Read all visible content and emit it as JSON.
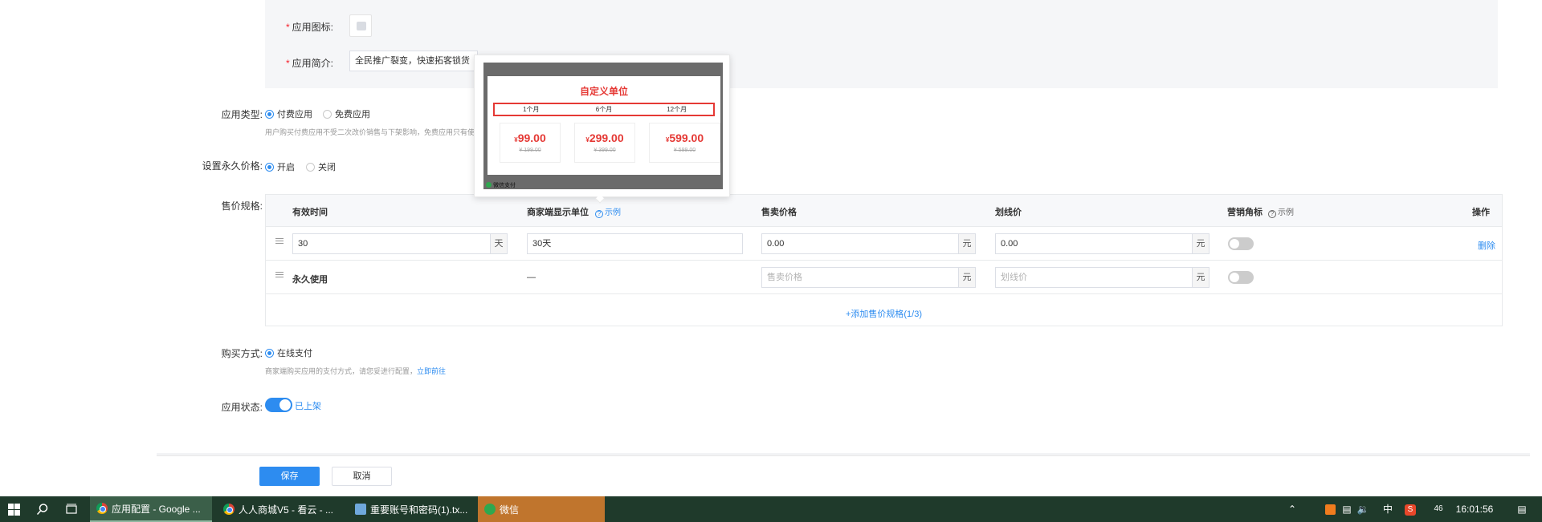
{
  "form": {
    "app_icon_label": "应用图标:",
    "app_intro_label": "应用简介:",
    "app_intro_value": "全民推广裂变，快速拓客锁货",
    "app_type_label": "应用类型:",
    "app_type_options": [
      "付费应用",
      "免费应用"
    ],
    "app_type_hint": "用户购买付费应用不受二次改价销售与下架影响，免费应用只有使",
    "perm_price_label": "设置永久价格:",
    "perm_price_options": [
      "开启",
      "关闭"
    ],
    "spec_label": "售价规格:",
    "purchase_label": "购买方式:",
    "purchase_option": "在线支付",
    "purchase_hint": "商家端购买应用的支付方式，请您妥进行配置，",
    "purchase_hint_link": "立即前往",
    "status_label": "应用状态:",
    "status_value": "已上架"
  },
  "spec_table": {
    "headers": {
      "duration": "有效时间",
      "unit": "商家端显示单位",
      "unit_help": "示例",
      "price": "售卖价格",
      "strike": "划线价",
      "badge": "营销角标",
      "badge_help": "示例",
      "action": "操作"
    },
    "rows": [
      {
        "duration": "30",
        "duration_suffix": "天",
        "unit": "30天",
        "price": "0.00",
        "price_suffix": "元",
        "strike": "0.00",
        "strike_suffix": "元",
        "action": "删除"
      },
      {
        "duration": "永久使用",
        "unit": "—",
        "price_placeholder": "售卖价格",
        "price_suffix": "元",
        "strike_placeholder": "划线价",
        "strike_suffix": "元"
      }
    ],
    "add_link": "+添加售价规格(1/3)"
  },
  "popover": {
    "title": "自定义单位",
    "tabs": [
      "1个月",
      "6个月",
      "12个月"
    ],
    "prices": [
      {
        "value": "99.00",
        "orig": "¥ 199.00"
      },
      {
        "value": "299.00",
        "orig": "¥ 399.00"
      },
      {
        "value": "599.00",
        "orig": "¥ 599.00"
      }
    ],
    "currency": "¥",
    "wechat_pay": "微信支付"
  },
  "buttons": {
    "save": "保存",
    "cancel": "取消"
  },
  "taskbar": {
    "tasks": [
      "应用配置 - Google ...",
      "人人商城V5 - 看云 - ...",
      "重要账号和密码(1).tx...",
      "微信"
    ],
    "tray": {
      "ime": "中",
      "time": "16:01:56",
      "badge": "46"
    }
  },
  "colors": {
    "accent": "#2d8cf0",
    "danger": "#f5222d",
    "taskbar": "#1f3a2b",
    "wechat_task": "#c0752d"
  }
}
